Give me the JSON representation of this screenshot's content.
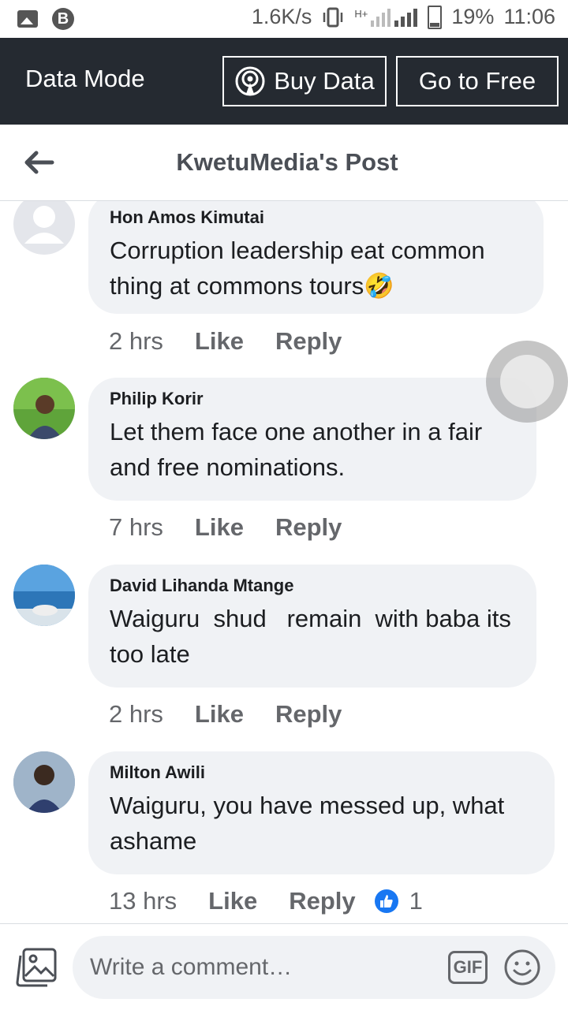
{
  "status_bar": {
    "speed": "1.6K/s",
    "network": "H+",
    "battery": "19%",
    "time": "11:06"
  },
  "data_mode": {
    "label": "Data Mode",
    "buy_button": "Buy Data",
    "free_button": "Go to Free"
  },
  "header": {
    "title": "KwetuMedia's Post"
  },
  "comments": [
    {
      "author": "Hon Amos Kimutai",
      "text": "Corruption leadership eat common thing at commons tours",
      "emoji": "🤣",
      "time": "2 hrs",
      "like": "Like",
      "reply": "Reply"
    },
    {
      "author": "Philip Korir",
      "text": "Let them face one another in a fair and free nominations.",
      "time": "7 hrs",
      "like": "Like",
      "reply": "Reply"
    },
    {
      "author": "David Lihanda Mtange",
      "text": "Waiguru  shud   remain  with baba its too late",
      "time": "2 hrs",
      "like": "Like",
      "reply": "Reply"
    },
    {
      "author": "Milton Awili",
      "text": "Waiguru, you have messed up, what ashame",
      "time": "13 hrs",
      "like": "Like",
      "reply": "Reply",
      "reaction_count": "1"
    }
  ],
  "composer": {
    "placeholder": "Write a comment…",
    "gif_label": "GIF"
  },
  "colors": {
    "data_mode_bg": "#252a31",
    "bubble_bg": "#f0f2f5",
    "like_blue": "#1877f2"
  }
}
